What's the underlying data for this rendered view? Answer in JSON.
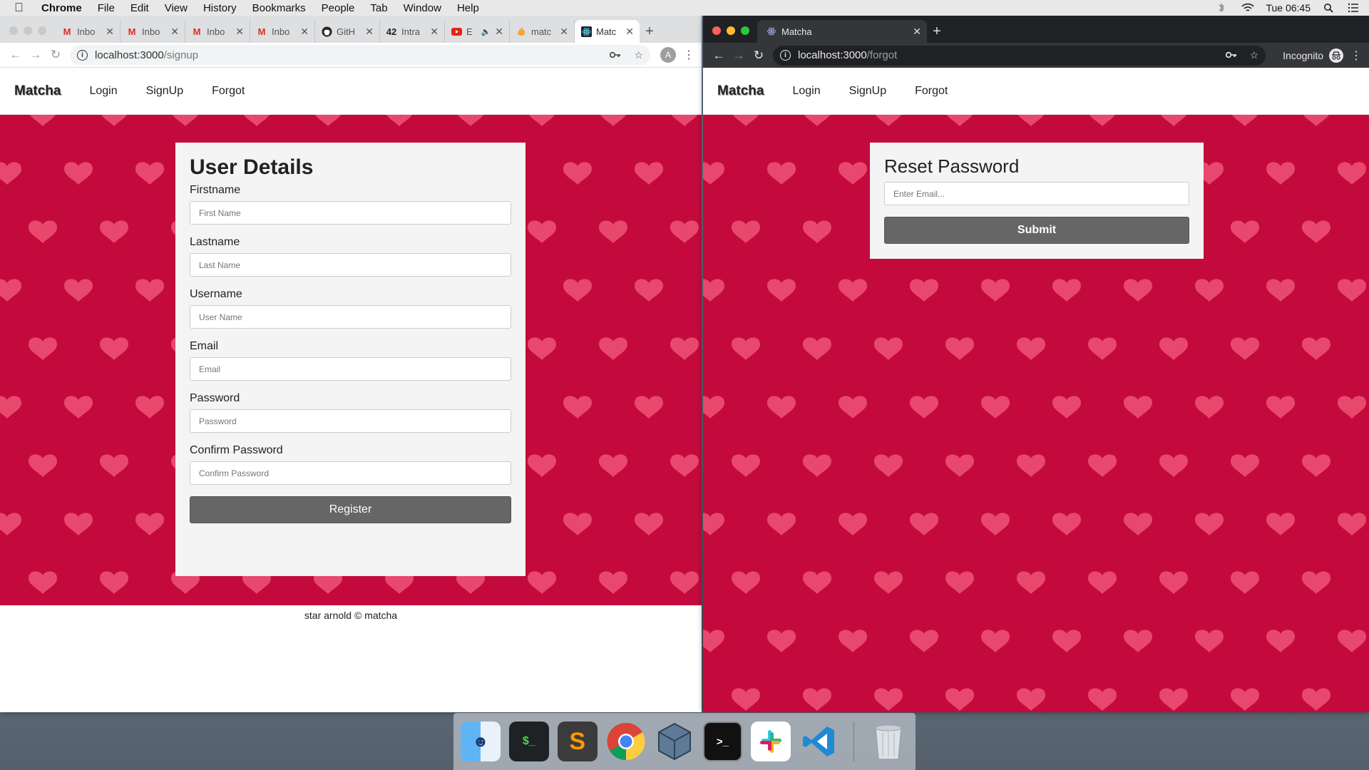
{
  "menubar": {
    "app": "Chrome",
    "items": [
      "File",
      "Edit",
      "View",
      "History",
      "Bookmarks",
      "People",
      "Tab",
      "Window",
      "Help"
    ],
    "clock": "Tue 06:45"
  },
  "left_window": {
    "tabs": [
      {
        "label": "Inbo",
        "icon": "gmail-icon"
      },
      {
        "label": "Inbo",
        "icon": "gmail-icon"
      },
      {
        "label": "Inbo",
        "icon": "gmail-icon"
      },
      {
        "label": "Inbo",
        "icon": "gmail-icon"
      },
      {
        "label": "GitH",
        "icon": "github-icon"
      },
      {
        "label": "Intra",
        "icon": "intra-icon"
      },
      {
        "label": "E",
        "icon": "youtube-icon"
      },
      {
        "label": "matc",
        "icon": "matcha-flame-icon"
      },
      {
        "label": "Matc",
        "icon": "react-icon"
      }
    ],
    "url_host": "localhost:3000",
    "url_path": "/signup",
    "avatar_letter": "A"
  },
  "right_window": {
    "tab_label": "Matcha",
    "url_host": "localhost:3000",
    "url_path": "/forgot",
    "incognito_label": "Incognito"
  },
  "site": {
    "brand": "Matcha",
    "nav": [
      "Login",
      "SignUp",
      "Forgot"
    ],
    "footer": "star arnold © matcha"
  },
  "signup": {
    "title": "User Details",
    "fields": [
      {
        "label": "Firstname",
        "placeholder": "First Name"
      },
      {
        "label": "Lastname",
        "placeholder": "Last Name"
      },
      {
        "label": "Username",
        "placeholder": "User Name"
      },
      {
        "label": "Email",
        "placeholder": "Email"
      },
      {
        "label": "Password",
        "placeholder": "Password"
      },
      {
        "label": "Confirm Password",
        "placeholder": "Confirm Password"
      }
    ],
    "submit": "Register"
  },
  "reset": {
    "title": "Reset Password",
    "placeholder": "Enter Email...",
    "submit": "Submit"
  },
  "colors": {
    "background_red": "#c40a3c",
    "heart_pink": "#e8486e",
    "button_gray": "#666666"
  }
}
